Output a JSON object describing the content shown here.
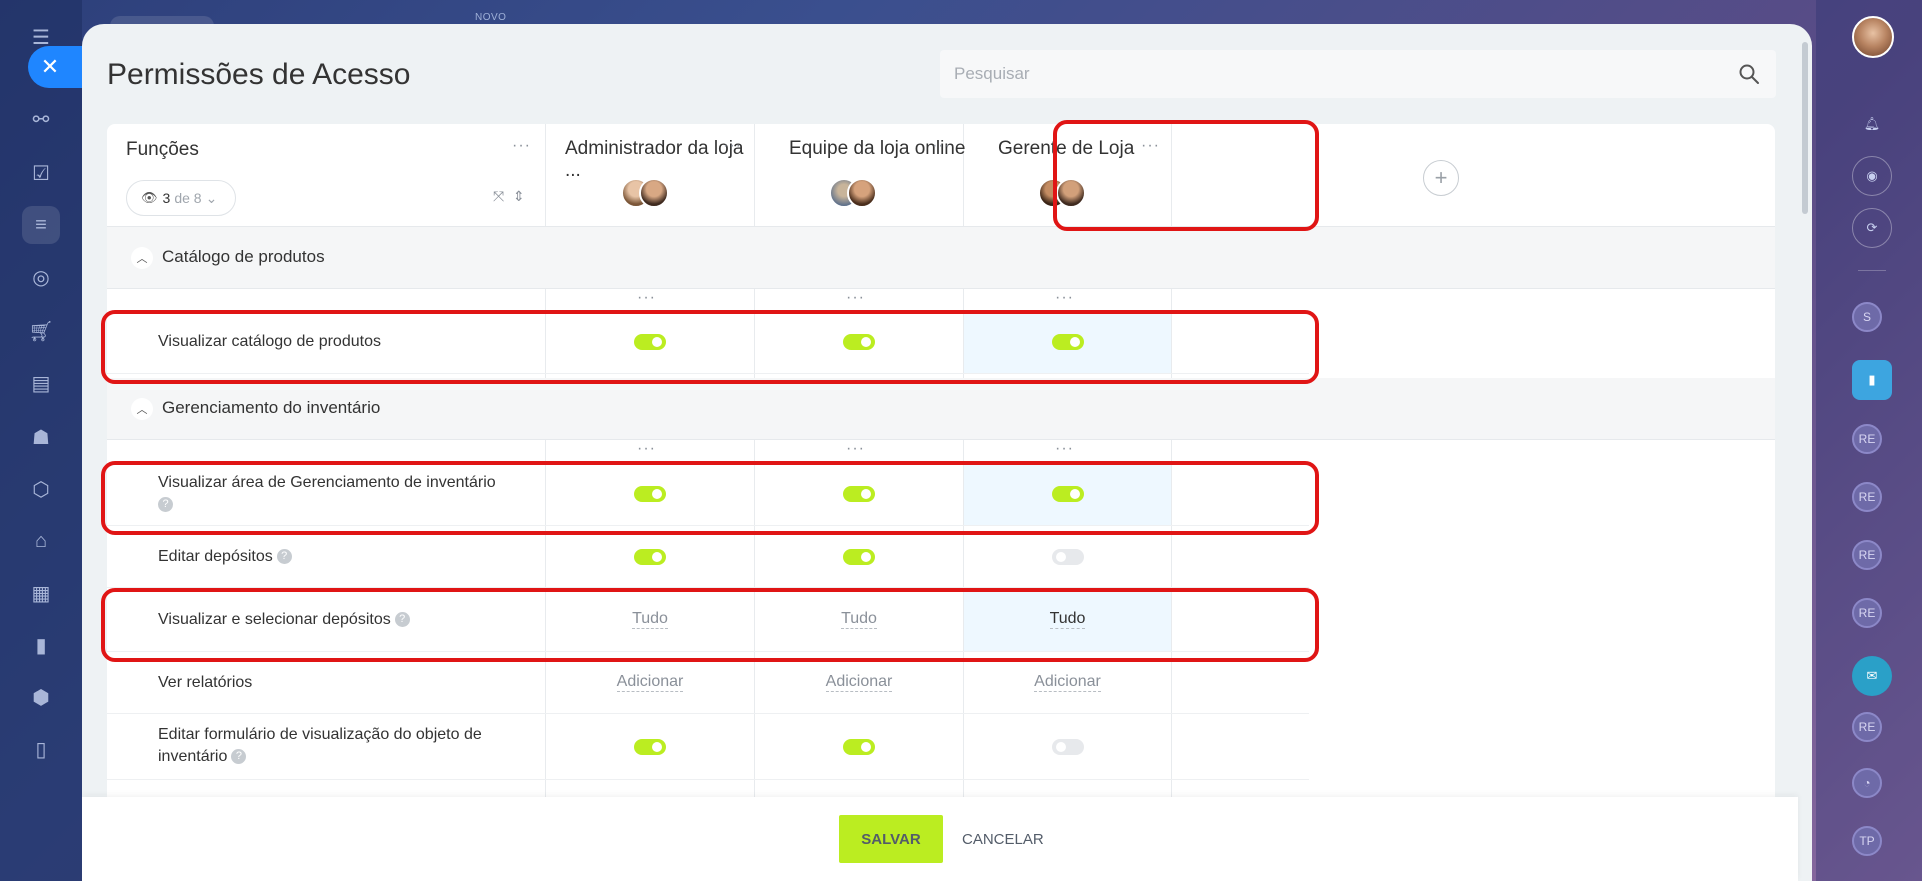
{
  "topbar": {
    "novo_label": "NOVO"
  },
  "nav": {
    "icons": [
      "menu-icon",
      "close-icon",
      "network-icon",
      "task-icon",
      "filter-icon",
      "target-icon",
      "cart-icon",
      "contact-card-icon",
      "robot-icon",
      "box-icon",
      "warehouse-icon",
      "calendar-icon",
      "bar-chart-icon",
      "shield-icon",
      "document-icon"
    ]
  },
  "right_sidebar": {
    "avatars": [
      "S",
      "RE",
      "RE",
      "RE",
      "RE",
      "RE",
      "TP"
    ]
  },
  "page": {
    "title": "Permissões de Acesso"
  },
  "search": {
    "placeholder": "Pesquisar"
  },
  "header": {
    "roles_label": "Funções",
    "filter": {
      "count": "3",
      "of_label": "de 8"
    },
    "columns": [
      {
        "label": "Administrador da loja ..."
      },
      {
        "label": "Equipe da loja online"
      },
      {
        "label": "Gerente de Loja"
      }
    ]
  },
  "sections": [
    {
      "title": "Catálogo de produtos",
      "rows": [
        {
          "label": "Visualizar catálogo de produtos",
          "values": [
            "on",
            "on",
            "on"
          ]
        }
      ]
    },
    {
      "title": "Gerenciamento do inventário",
      "rows": [
        {
          "label": "Visualizar área de Gerenciamento de inventário",
          "values": [
            "on",
            "on",
            "on"
          ]
        },
        {
          "label": "Editar depósitos",
          "values": [
            "on",
            "on",
            "off"
          ]
        },
        {
          "label": "Visualizar e selecionar depósitos",
          "values": [
            "Tudo",
            "Tudo",
            "Tudo"
          ]
        },
        {
          "label": "Ver relatórios",
          "values": [
            "Adicionar",
            "Adicionar",
            "Adicionar"
          ]
        },
        {
          "label": "Editar formulário de visualização do objeto de inventário",
          "values": [
            "on",
            "on",
            "off"
          ]
        }
      ]
    }
  ],
  "footer": {
    "save_label": "SALVAR",
    "cancel_label": "CANCELAR"
  },
  "colors": {
    "accent_green": "#bbed21",
    "highlight_red": "#e01515",
    "close_blue": "#1f86ff"
  }
}
